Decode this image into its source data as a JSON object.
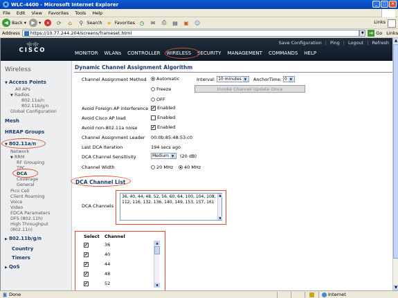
{
  "window": {
    "title": "WLC-4400 - Microsoft Internet Explorer"
  },
  "menubar": [
    "File",
    "Edit",
    "View",
    "Favorites",
    "Tools",
    "Help"
  ],
  "toolbar": {
    "back": "Back",
    "search": "Search",
    "favorites": "Favorites"
  },
  "links_label": "Links",
  "address": {
    "label": "Address",
    "url": "https://10.77.244.204/screens/frameset.html",
    "go": "Go",
    "links": "Links"
  },
  "header": {
    "logo": "CISCO",
    "util": [
      "Save Configuration",
      "Ping",
      "Logout",
      "Refresh"
    ],
    "nav": [
      "MONITOR",
      "WLANs",
      "CONTROLLER",
      "WIRELESS",
      "SECURITY",
      "MANAGEMENT",
      "COMMANDS",
      "HELP"
    ]
  },
  "sidebar": {
    "title": "Wireless",
    "access_points": "Access Points",
    "ap_items": [
      "All APs",
      "Radios",
      "802.11a/n",
      "802.11b/g/n",
      "Global Configuration"
    ],
    "mesh": "Mesh",
    "hreap": "HREAP Groups",
    "a_n": "802.11a/n",
    "a_n_items": [
      "Network",
      "RRM",
      "RF Grouping",
      "TPC",
      "DCA",
      "Coverage",
      "General",
      "Pico Cell",
      "Client Roaming",
      "Voice",
      "Video",
      "EDCA Parameters",
      "DFS (802.11h)",
      "High Throughput",
      "(802.11n)"
    ],
    "b_g_n": "802.11b/g/n",
    "country": "Country",
    "timers": "Timers",
    "qos": "QoS"
  },
  "content": {
    "title": "Dynamic Channel Assignment Algorithm",
    "method_label": "Channel Assignment Method",
    "method_options": [
      "Automatic",
      "Freeze",
      "OFF"
    ],
    "interval_label": "Interval:",
    "interval_value": "10 minutes",
    "anchor_label": "AnchorTime:",
    "anchor_value": "0",
    "invoke_button": "Invoke Channel Update Once",
    "avoid_foreign_label": "Avoid Foreign AP interference",
    "avoid_foreign_value": "Enabled",
    "avoid_cisco_label": "Avoid Cisco AP load",
    "avoid_cisco_value": "Enabled",
    "avoid_noise_label": "Avoid non-802.11a noise",
    "avoid_noise_value": "Enabled",
    "leader_label": "Channel Assignment Leader",
    "leader_value": "00:0b:85:48:53:c0",
    "last_dca_label": "Last DCA Iteration",
    "last_dca_value": "194 secs ago",
    "sensitivity_label": "DCA Channel Sensitivity",
    "sensitivity_value": "Medium",
    "sensitivity_db": "(20 dB)",
    "width_label": "Channel Width",
    "width_options": [
      "20 MHz",
      "40 MHz"
    ],
    "dca_list_title": "DCA Channel List",
    "dca_channels_label": "DCA Channels",
    "dca_channels_value": "36, 40, 44, 48, 52, 56, 60, 64, 100, 104, 108, 112, 116, 132, 136, 140, 149, 153, 157, 161",
    "table_headers": [
      "Select",
      "Channel"
    ],
    "table_rows": [
      "36",
      "40",
      "44",
      "48",
      "52"
    ]
  },
  "status": {
    "left": "Done",
    "zone": "Internet"
  }
}
